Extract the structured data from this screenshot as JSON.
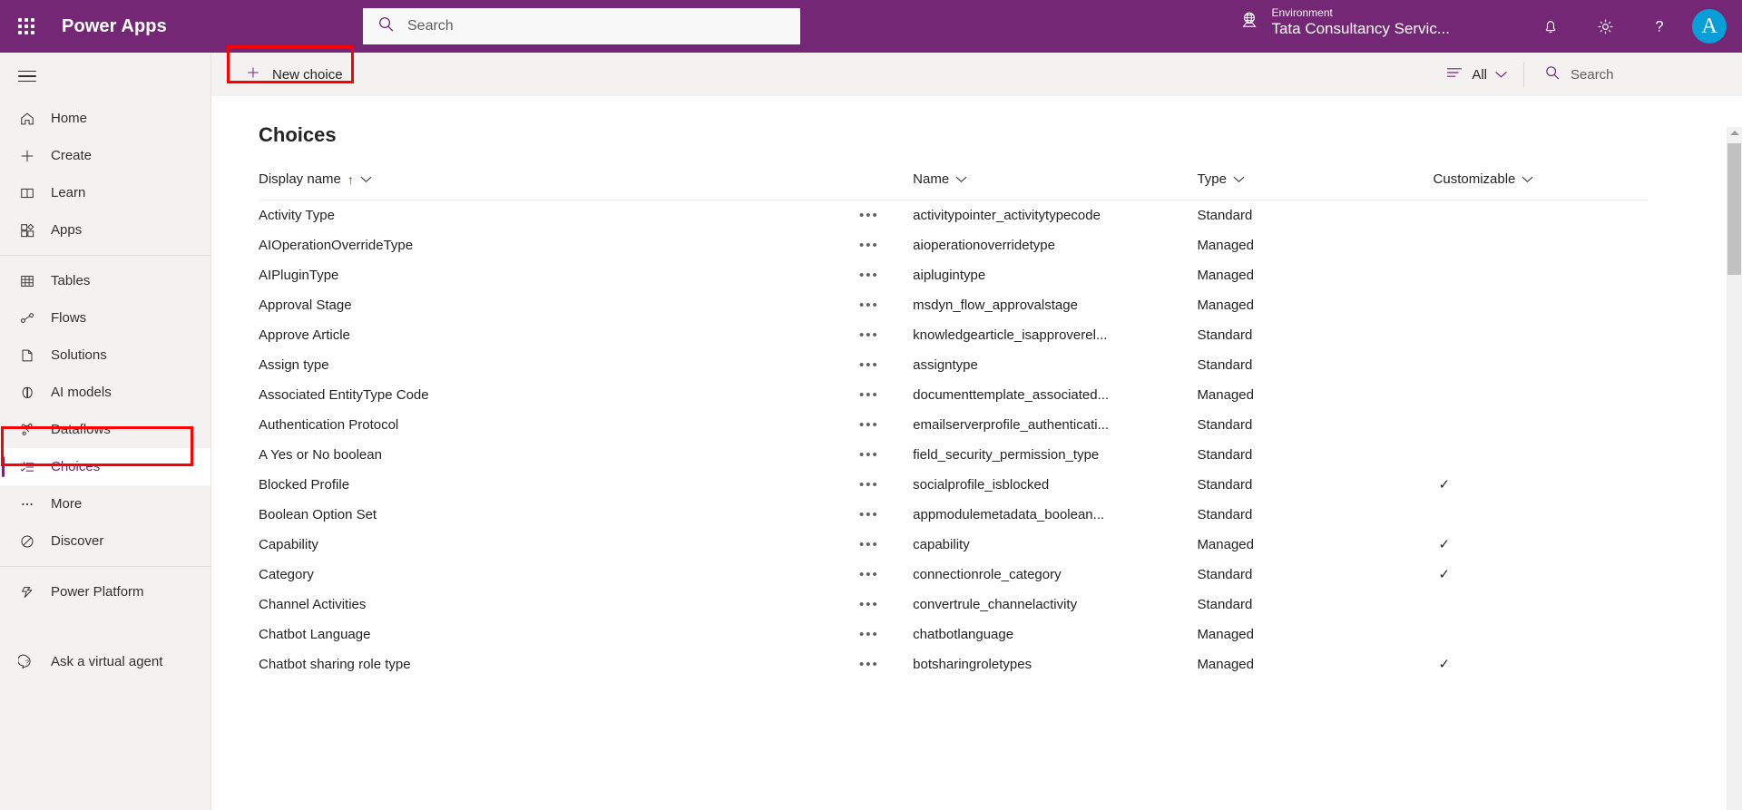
{
  "header": {
    "waffle_icon": "app-launcher-icon",
    "brand": "Power Apps",
    "search": {
      "placeholder": "Search",
      "value": "",
      "icon": "search-icon"
    },
    "environment": {
      "icon": "globe-icon",
      "label": "Environment",
      "name": "Tata Consultancy Servic..."
    },
    "icons": {
      "notifications": "bell-icon",
      "settings": "gear-icon",
      "help": "question-mark-icon"
    },
    "avatar_initial": "A",
    "colors": {
      "brand_purple": "#742774",
      "avatar_blue": "#0a9ed9",
      "highlight_red": "#ff0000"
    }
  },
  "sidebar": {
    "menu_icon": "hamburger-icon",
    "items": [
      {
        "label": "Home",
        "icon": "home-icon",
        "selected": false
      },
      {
        "label": "Create",
        "icon": "plus-icon",
        "selected": false
      },
      {
        "label": "Learn",
        "icon": "book-icon",
        "selected": false
      },
      {
        "label": "Apps",
        "icon": "apps-icon",
        "selected": false
      },
      {
        "label": "Tables",
        "icon": "table-icon",
        "selected": false
      },
      {
        "label": "Flows",
        "icon": "flow-icon",
        "selected": false
      },
      {
        "label": "Solutions",
        "icon": "solutions-icon",
        "selected": false
      },
      {
        "label": "AI models",
        "icon": "ai-model-icon",
        "selected": false
      },
      {
        "label": "Dataflows",
        "icon": "dataflows-icon",
        "selected": false
      },
      {
        "label": "Choices",
        "icon": "choices-icon",
        "selected": true
      },
      {
        "label": "More",
        "icon": "ellipsis-icon",
        "selected": false
      },
      {
        "label": "Discover",
        "icon": "discover-icon",
        "selected": false
      },
      {
        "label": "Power Platform",
        "icon": "power-platform-icon",
        "selected": false
      },
      {
        "label": "Ask a virtual agent",
        "icon": "chat-question-icon",
        "selected": false
      }
    ]
  },
  "command_bar": {
    "new_choice_label": "New choice",
    "new_choice_icon": "plus-icon",
    "filter_label": "All",
    "filter_icon": "filter-icon",
    "filter_chevron": "chevron-down-icon",
    "search_placeholder": "Search",
    "search_icon": "search-icon"
  },
  "main": {
    "title": "Choices",
    "columns": [
      {
        "key": "display_name",
        "label": "Display name",
        "sorted": "asc"
      },
      {
        "key": "name",
        "label": "Name"
      },
      {
        "key": "type",
        "label": "Type"
      },
      {
        "key": "customizable",
        "label": "Customizable"
      }
    ],
    "sort_indicator": "↑",
    "rows": [
      {
        "display_name": "Activity Type",
        "name": "activitypointer_activitytypecode",
        "type": "Standard",
        "customizable": ""
      },
      {
        "display_name": "AIOperationOverrideType",
        "name": "aioperationoverridetype",
        "type": "Managed",
        "customizable": ""
      },
      {
        "display_name": "AIPluginType",
        "name": "aiplugintype",
        "type": "Managed",
        "customizable": ""
      },
      {
        "display_name": "Approval Stage",
        "name": "msdyn_flow_approvalstage",
        "type": "Managed",
        "customizable": ""
      },
      {
        "display_name": "Approve Article",
        "name": "knowledgearticle_isapproverel...",
        "type": "Standard",
        "customizable": ""
      },
      {
        "display_name": "Assign type",
        "name": "assigntype",
        "type": "Standard",
        "customizable": ""
      },
      {
        "display_name": "Associated EntityType Code",
        "name": "documenttemplate_associated...",
        "type": "Managed",
        "customizable": ""
      },
      {
        "display_name": "Authentication Protocol",
        "name": "emailserverprofile_authenticati...",
        "type": "Standard",
        "customizable": ""
      },
      {
        "display_name": "A Yes or No boolean",
        "name": "field_security_permission_type",
        "type": "Standard",
        "customizable": ""
      },
      {
        "display_name": "Blocked Profile",
        "name": "socialprofile_isblocked",
        "type": "Standard",
        "customizable": "✓"
      },
      {
        "display_name": "Boolean Option Set",
        "name": "appmodulemetadata_boolean...",
        "type": "Standard",
        "customizable": ""
      },
      {
        "display_name": "Capability",
        "name": "capability",
        "type": "Managed",
        "customizable": "✓"
      },
      {
        "display_name": "Category",
        "name": "connectionrole_category",
        "type": "Standard",
        "customizable": "✓"
      },
      {
        "display_name": "Channel Activities",
        "name": "convertrule_channelactivity",
        "type": "Standard",
        "customizable": ""
      },
      {
        "display_name": "Chatbot Language",
        "name": "chatbotlanguage",
        "type": "Managed",
        "customizable": ""
      },
      {
        "display_name": "Chatbot sharing role type",
        "name": "botsharingroletypes",
        "type": "Managed",
        "customizable": "✓"
      }
    ],
    "row_menu_glyph": "•••"
  }
}
